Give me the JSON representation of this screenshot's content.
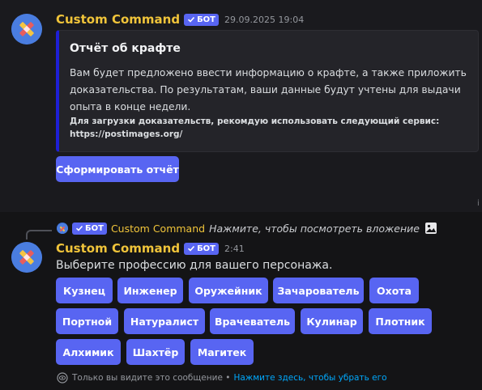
{
  "colors": {
    "accent": "#5865f2",
    "username": "#f0c43a",
    "embed_bar": "#1e1fd6",
    "link": "#00a8fc"
  },
  "message1": {
    "avatar_icon": "pencil-ruler-icon",
    "username": "Custom Command",
    "bot_badge": "БОТ",
    "timestamp": "29.09.2025 19:04",
    "embed": {
      "title": "Отчёт об крафте",
      "description": "Вам будет предложено ввести информацию о крафте, а также приложить доказательства. По результатам, ваши данные будут учтены для выдачи опыта в конце недели.",
      "note_line1": "Для загрузки доказательств, рекомдую использовать следующий сервис:",
      "note_line2": "https://postimages.org/"
    },
    "button_label": "Сформировать отчёт"
  },
  "message2": {
    "reply": {
      "bot_badge": "БОТ",
      "username": "Custom Command",
      "text": "Нажмите, чтобы посмотреть вложение",
      "icon": "image-icon"
    },
    "avatar_icon": "pencil-ruler-icon",
    "username": "Custom Command",
    "bot_badge": "БОТ",
    "timestamp": "2:41",
    "text": "Выберите профессию для вашего персонажа.",
    "buttons": [
      "Кузнец",
      "Инженер",
      "Оружейник",
      "Зачарователь",
      "Охота",
      "Портной",
      "Натуралист",
      "Врачеватель",
      "Кулинар",
      "Плотник",
      "Алхимик",
      "Шахтёр",
      "Магитек"
    ],
    "ephemeral_text": "Только вы видите это сообщение •",
    "ephemeral_link": "Нажмите здесь, чтобы убрать его",
    "ephemeral_icon": "eye-icon"
  }
}
